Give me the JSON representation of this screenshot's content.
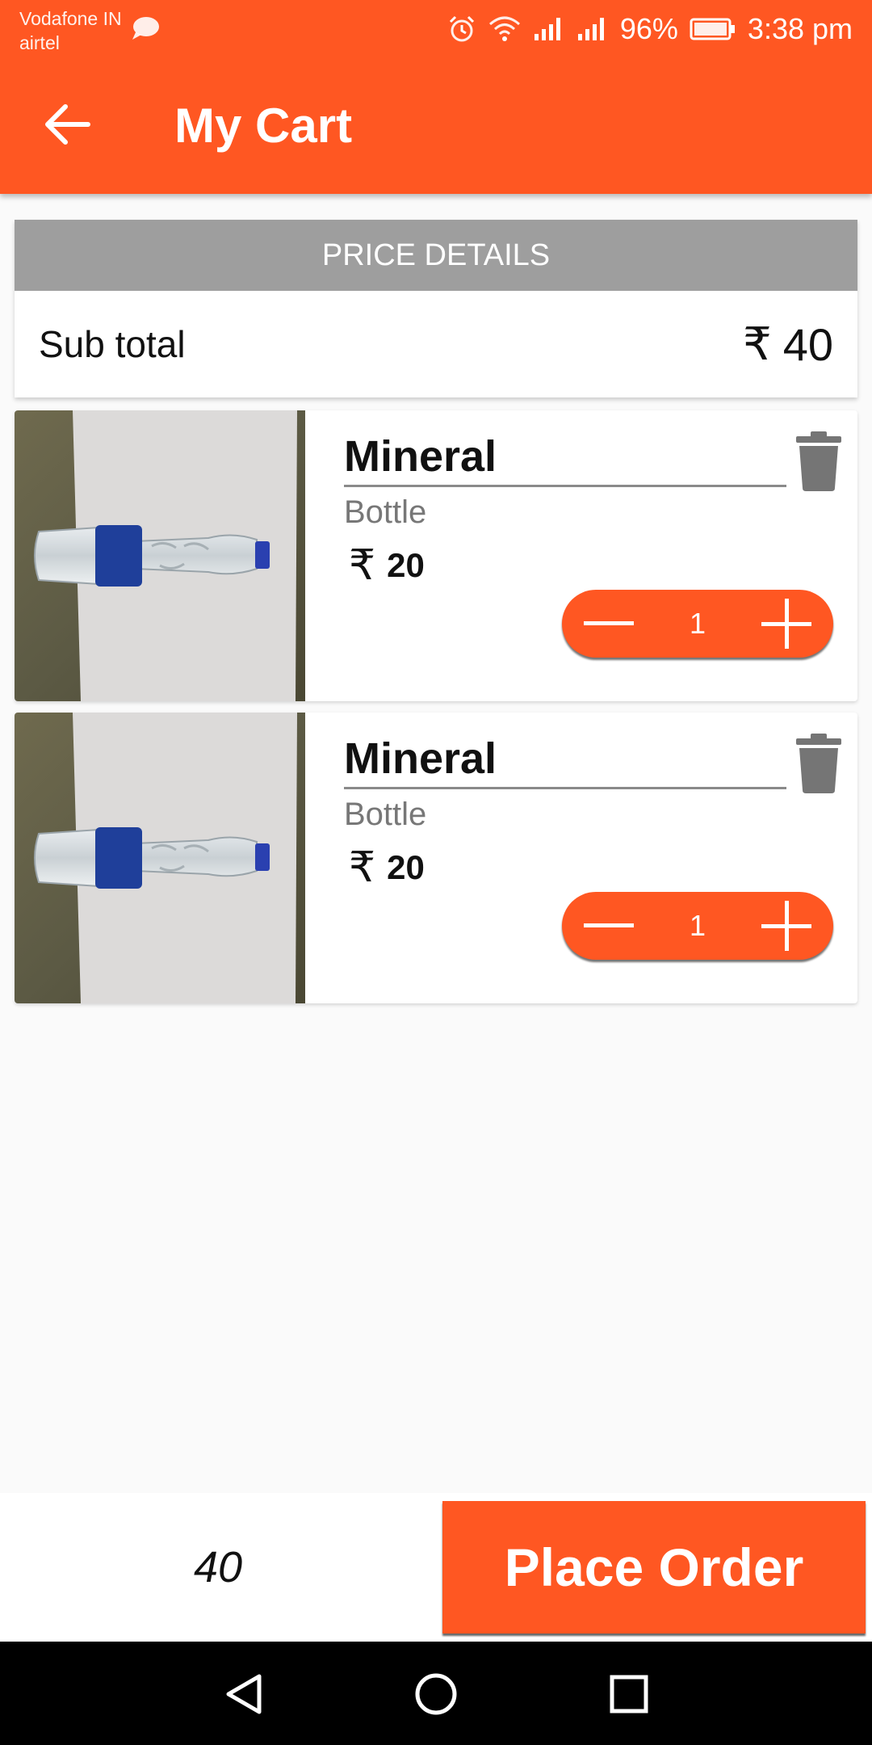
{
  "status_bar": {
    "carrier_1": "Vodafone IN",
    "carrier_2": "airtel",
    "battery": "96%",
    "time": "3:38 pm",
    "icons": [
      "chat-icon",
      "alarm-icon",
      "wifi-icon",
      "signal-icon",
      "signal-icon",
      "battery-icon"
    ]
  },
  "app_bar": {
    "title": "My Cart",
    "back_icon": "arrow-left-icon",
    "color": "#ff5722"
  },
  "price_details": {
    "header": "PRICE DETAILS",
    "subtotal_label": "Sub total",
    "currency": "₹",
    "subtotal_value": "40"
  },
  "cart_items": [
    {
      "name": "Mineral",
      "type": "Bottle",
      "currency": "₹",
      "price": "20",
      "quantity": "1"
    },
    {
      "name": "Mineral",
      "type": "Bottle",
      "currency": "₹",
      "price": "20",
      "quantity": "1"
    }
  ],
  "bottom_bar": {
    "total": "40",
    "place_order_label": "Place Order"
  },
  "nav_bar": {
    "icons": [
      "back-triangle-icon",
      "home-circle-icon",
      "recents-square-icon"
    ]
  }
}
